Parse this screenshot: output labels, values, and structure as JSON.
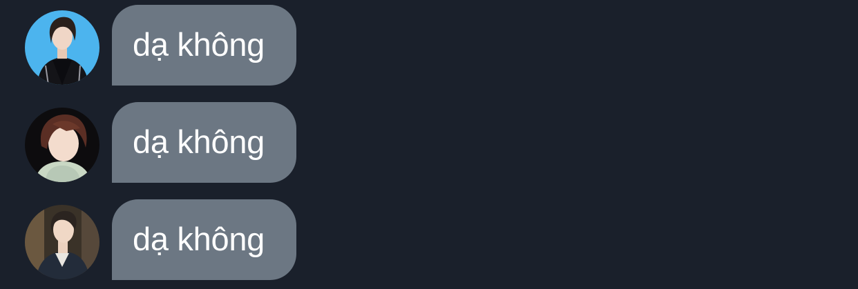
{
  "messages": [
    {
      "text": "dạ không",
      "avatar_icon": "user-avatar-icon",
      "avatar_bg": "#4cb4ee"
    },
    {
      "text": "dạ không",
      "avatar_icon": "user-avatar-icon",
      "avatar_bg": "#0d0c0e"
    },
    {
      "text": "dạ không",
      "avatar_icon": "user-avatar-icon",
      "avatar_bg": "#3a3228"
    }
  ],
  "colors": {
    "background": "#1a202b",
    "bubble": "#6c7783",
    "text": "#ffffff"
  }
}
